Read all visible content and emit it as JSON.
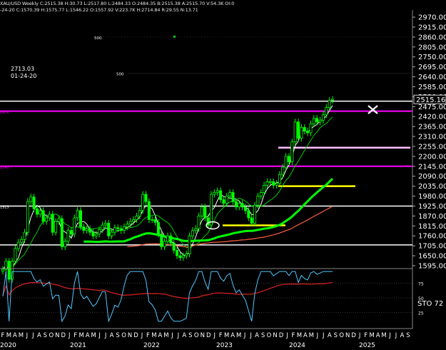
{
  "header": {
    "line1": "XAU/USD Weekly  C:2515.38  H:30.73  L:2517.80  L:2484.33  O:2484.35  B:2515.38  A:2515.70  V:54.3K  OI:0",
    "line2": "-24-20  C:1570.39  H:1575.77  L:1546.22  O:1557.92  V:223.7K  H:2714.84  R:29.55  N:13.71"
  },
  "peak_label": {
    "value": "2713.03",
    "date": "01-24-20"
  },
  "stochastic_label": "STO  72",
  "colors": {
    "background": "#000000",
    "candle": "#00ff00",
    "magenta_line": "#ff00ff",
    "white_line": "#ffffff",
    "yellow_line": "#ffff00",
    "pink_line": "#ffc0ff",
    "ma_fast": "#ffffff",
    "ma_mid": "#00cc00",
    "ma_slow": "#00ff00",
    "ma_long": "#ff6040",
    "stoch_main": "#4fc8ff",
    "stoch_signal": "#d02020"
  },
  "chart_data": {
    "type": "candlestick",
    "title": "XAU/USD Weekly",
    "price_axis": {
      "ticks": [
        2970,
        2915,
        2860,
        2805,
        2750,
        2695,
        2640,
        2585,
        2530,
        2475,
        2420,
        2365,
        2310,
        2255,
        2200,
        2145,
        2090,
        2035,
        1980,
        1925,
        1870,
        1815,
        1760,
        1705,
        1650,
        1595
      ],
      "last_price": "2515.16",
      "range": [
        1595,
        2970
      ]
    },
    "stochastic_axis": {
      "ticks": [
        "75",
        "50",
        "25"
      ],
      "range": [
        0,
        100
      ]
    },
    "time_axis": {
      "months": [
        "F",
        "M",
        "A",
        "M",
        "J",
        "J",
        "A",
        "S",
        "O",
        "N",
        "D",
        "J",
        "F",
        "M",
        "A",
        "M",
        "J",
        "J",
        "A",
        "S",
        "O",
        "N",
        "D",
        "J",
        "F",
        "M",
        "A",
        "M",
        "J",
        "J",
        "A",
        "S",
        "O",
        "N",
        "D",
        "J",
        "F",
        "M",
        "A",
        "M",
        "J",
        "J",
        "A",
        "S",
        "O",
        "N",
        "D",
        "J",
        "F",
        "M",
        "A",
        "M",
        "J",
        "J",
        "A",
        "S",
        "O",
        "N",
        "D",
        "J",
        "F",
        "M",
        "A",
        "M",
        "J",
        "J",
        "A",
        "S"
      ],
      "years": [
        "2020",
        "2021",
        "2022",
        "2023",
        "2024",
        "2025"
      ]
    },
    "horizontal_levels": [
      {
        "price": 2450,
        "color": "magenta",
        "label": "2450"
      },
      {
        "price": 2145,
        "color": "magenta",
        "label": "2145"
      },
      {
        "price": 1925,
        "color": "white",
        "label": "1925"
      },
      {
        "price": 2505,
        "color": "white",
        "label": ""
      },
      {
        "price": 1710,
        "color": "white",
        "label": ""
      }
    ],
    "box_labels": [
      {
        "text": "500",
        "price": 2860
      },
      {
        "text": "500",
        "price": 2660
      }
    ],
    "weekly_close": [
      1575,
      1620,
      1520,
      1620,
      1690,
      1725,
      1740,
      1780,
      1950,
      1975,
      1910,
      1880,
      1900,
      1840,
      1860,
      1880,
      1780,
      1840,
      1855,
      1700,
      1730,
      1790,
      1770,
      1860,
      1900,
      1810,
      1790,
      1800,
      1780,
      1760,
      1770,
      1795,
      1820,
      1830,
      1760,
      1780,
      1805,
      1800,
      1790,
      1810,
      1825,
      1840,
      1850,
      1870,
      1900,
      1990,
      1950,
      1850,
      1850,
      1835,
      1770,
      1700,
      1730,
      1760,
      1720,
      1680,
      1650,
      1640,
      1650,
      1660,
      1760,
      1790,
      1800,
      1870,
      1920,
      1860,
      1820,
      1990,
      2000,
      2010,
      1960,
      1940,
      1980,
      2000,
      1950,
      1920,
      1940,
      1920,
      1900,
      1860,
      1830,
      1930,
      1980,
      2000,
      2040,
      2060,
      2060,
      2040,
      2050,
      2100,
      2140,
      2200,
      2170,
      2280,
      2390,
      2300,
      2360,
      2340,
      2330,
      2380,
      2410,
      2390,
      2400,
      2430,
      2470,
      2510,
      2515
    ]
  }
}
